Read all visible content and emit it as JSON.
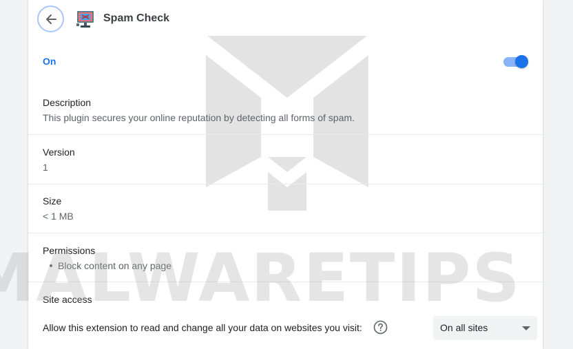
{
  "header": {
    "title": "Spam Check",
    "back_icon": "arrow-left-icon",
    "extension_icon": "monitor-icon"
  },
  "toggle_section": {
    "label": "On",
    "enabled": true,
    "accent_color": "#1a73e8"
  },
  "description": {
    "title": "Description",
    "text": "This plugin secures your online reputation by detecting all forms of spam."
  },
  "version": {
    "title": "Version",
    "value": "1"
  },
  "size": {
    "title": "Size",
    "value": "< 1 MB"
  },
  "permissions": {
    "title": "Permissions",
    "items": [
      "Block content on any page"
    ]
  },
  "site_access": {
    "title": "Site access",
    "prompt": "Allow this extension to read and change all your data on websites you visit:",
    "help_icon": "help-circle-icon",
    "selected_option": "On all sites"
  },
  "watermark": {
    "text": "MALWARETIPS"
  }
}
